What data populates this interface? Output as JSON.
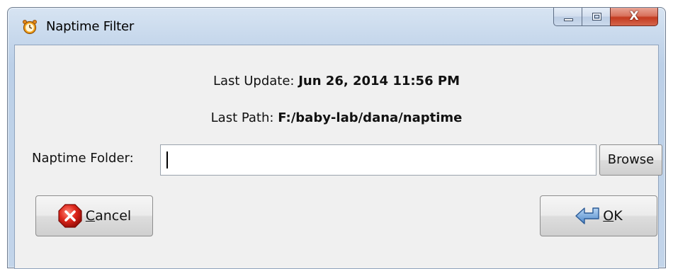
{
  "window": {
    "title": "Naptime Filter",
    "icon": "alarm-clock-icon",
    "close_glyph": "X"
  },
  "info": {
    "last_update_label": "Last Update:",
    "last_update_value": "Jun 26, 2014 11:56 PM",
    "last_path_label": "Last Path:",
    "last_path_value": "F:/baby-lab/dana/naptime"
  },
  "folder": {
    "label": "Naptime Folder:",
    "value": "",
    "browse_label": "Browse"
  },
  "actions": {
    "cancel_mnemonic": "C",
    "cancel_rest": "ancel",
    "cancel_icon": "cancel-x-icon",
    "ok_mnemonic": "O",
    "ok_rest": "K",
    "ok_icon": "enter-arrow-icon"
  },
  "colors": {
    "cancel_red": "#d9261c",
    "ok_blue": "#6b9ed6",
    "close_red": "#c43b20"
  }
}
